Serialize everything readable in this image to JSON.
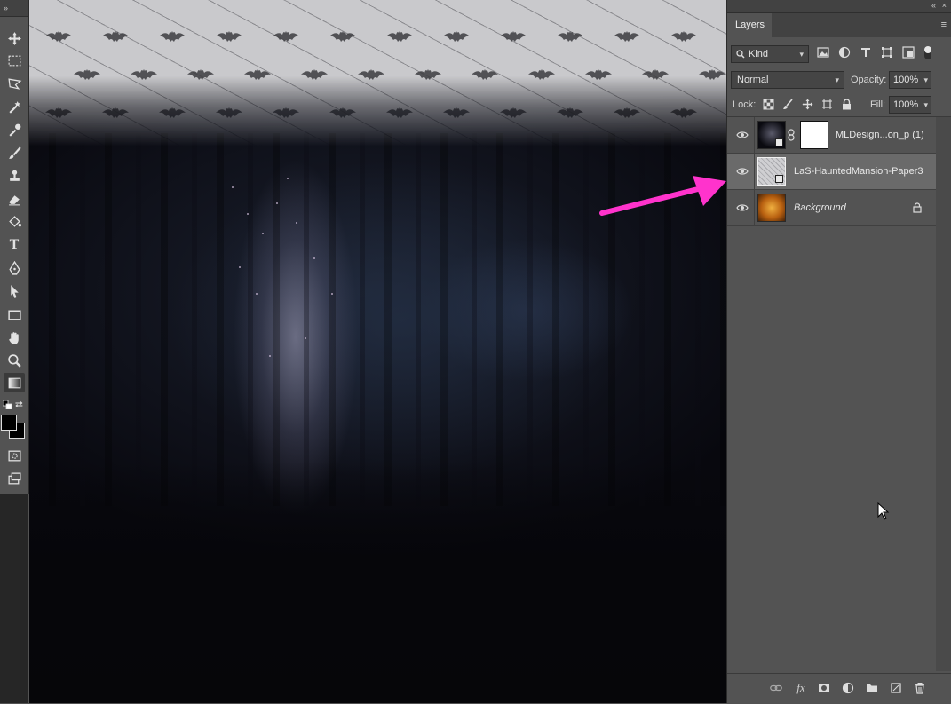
{
  "toolbar": {
    "collapse_glyph": "»",
    "tools": [
      {
        "name": "move-tool",
        "icon": "move-icon"
      },
      {
        "name": "marquee-tool",
        "icon": "rect-marquee-icon"
      },
      {
        "name": "lasso-tool",
        "icon": "polygonal-lasso-icon"
      },
      {
        "name": "magic-wand-tool",
        "icon": "magic-wand-icon"
      },
      {
        "name": "eyedropper-tool",
        "icon": "eyedropper-icon"
      },
      {
        "name": "brush-tool",
        "icon": "brush-icon"
      },
      {
        "name": "stamp-tool",
        "icon": "clone-stamp-icon"
      },
      {
        "name": "eraser-tool",
        "icon": "eraser-icon"
      },
      {
        "name": "paint-bucket-tool",
        "icon": "paint-bucket-icon"
      },
      {
        "name": "type-tool",
        "icon": "type-icon",
        "glyph": "T"
      },
      {
        "name": "pen-tool",
        "icon": "pen-icon"
      },
      {
        "name": "path-selection-tool",
        "icon": "arrow-select-icon"
      },
      {
        "name": "rectangle-tool",
        "icon": "rectangle-shape-icon"
      },
      {
        "name": "hand-tool",
        "icon": "hand-icon"
      },
      {
        "name": "zoom-tool",
        "icon": "zoom-icon"
      },
      {
        "name": "gradient-tool",
        "icon": "gradient-icon"
      }
    ],
    "foreground_color": "#000000",
    "background_color": "#000000"
  },
  "panel": {
    "collapse_glyph": "«",
    "close_glyph": "×",
    "tab_label": "Layers",
    "filter": {
      "kind_label": "Kind",
      "icons": [
        "image-filter-icon",
        "adjustment-filter-icon",
        "type-filter-icon",
        "shape-filter-icon",
        "smart-object-filter-icon"
      ]
    },
    "blend_mode": "Normal",
    "opacity_label": "Opacity:",
    "opacity_value": "100%",
    "lock_label": "Lock:",
    "lock_icons": [
      "lock-transparent-icon",
      "lock-image-icon",
      "lock-position-icon",
      "lock-artboard-icon",
      "lock-all-icon"
    ],
    "fill_label": "Fill:",
    "fill_value": "100%",
    "layers": [
      {
        "name": "MLDesign...on_p (1)",
        "visible": true,
        "selected": false,
        "has_mask": true,
        "italic": false
      },
      {
        "name": "LaS-HauntedMansion-Paper3",
        "visible": true,
        "selected": true,
        "has_mask": false,
        "italic": false
      },
      {
        "name": "Background",
        "visible": true,
        "selected": false,
        "has_mask": false,
        "italic": true,
        "locked": true
      }
    ],
    "bottom_icons": [
      "link-layers-icon",
      "fx-icon",
      "add-mask-icon",
      "adjustment-layer-icon",
      "new-group-icon",
      "new-layer-icon",
      "delete-layer-icon"
    ],
    "fx_glyph": "fx"
  },
  "annotation": {
    "arrow_color": "#ff33cc"
  }
}
